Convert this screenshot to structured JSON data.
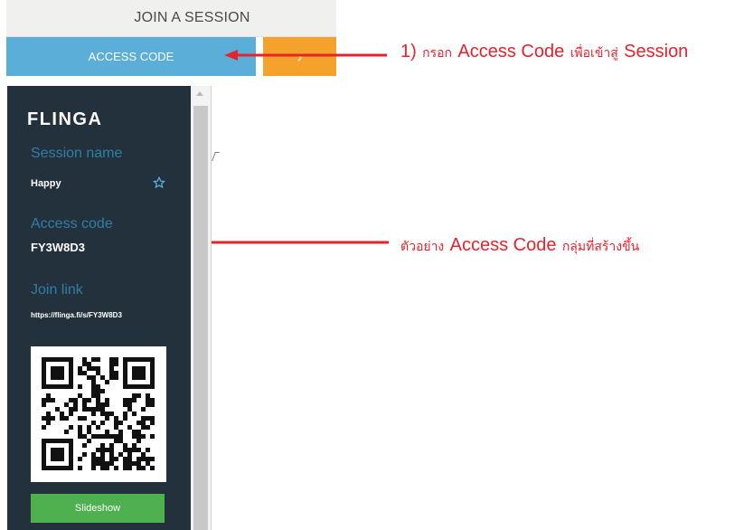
{
  "join_session": {
    "title": "JOIN A SESSION",
    "access_code_placeholder": "ACCESS CODE",
    "go_button_icon": "chevron-right-icon"
  },
  "callouts": {
    "step1": {
      "number": "1)",
      "thai_prefix": "กรอก",
      "term": "Access Code",
      "thai_middle": "เพื่อเข้าสู่",
      "target": "Session"
    },
    "example": {
      "thai_prefix": "ตัวอย่าง",
      "term": "Access Code",
      "thai_suffix": "กลุ่มที่สร้างขึ้น"
    },
    "color": "#e8222c"
  },
  "sidebar": {
    "logo": "FLINGA",
    "session_name_label": "Session name",
    "session_name_value": "Happy",
    "favorite_icon": "star-outline-icon",
    "access_code_label": "Access code",
    "access_code_value": "FY3W8D3",
    "join_link_label": "Join link",
    "join_link_value": "https://flinga.fi/s/FY3W8D3",
    "qr_icon": "qr-code-icon",
    "slideshow_label": "Slideshow"
  },
  "colors": {
    "access_field": "#5aaed8",
    "go_button": "#f4a22c",
    "sidebar_bg": "#23313d",
    "label_blue": "#2f7fa3",
    "slideshow_green": "#4fb04f"
  }
}
